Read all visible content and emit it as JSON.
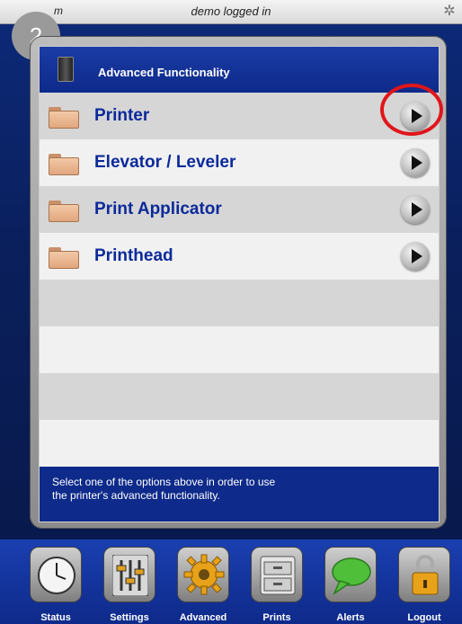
{
  "topbar": {
    "left_text": "m",
    "status": "demo logged in"
  },
  "badge": "2",
  "panel": {
    "title": "Advanced Functionality",
    "items": [
      {
        "label": "Printer"
      },
      {
        "label": "Elevator / Leveler"
      },
      {
        "label": "Print Applicator"
      },
      {
        "label": "Printhead"
      }
    ],
    "footer_lines": [
      "Select one of the options above in order to use",
      "the printer's advanced functionality."
    ]
  },
  "dock": [
    {
      "label": "Status",
      "icon": "clock-icon"
    },
    {
      "label": "Settings",
      "icon": "sliders-icon"
    },
    {
      "label": "Advanced",
      "icon": "gear-icon"
    },
    {
      "label": "Prints",
      "icon": "file-cabinet-icon"
    },
    {
      "label": "Alerts",
      "icon": "speech-bubble-icon"
    },
    {
      "label": "Logout",
      "icon": "padlock-icon"
    }
  ],
  "colors": {
    "accent_blue": "#0e2a8a",
    "label_blue": "#0b2a9a",
    "highlight_red": "#e0161b"
  }
}
